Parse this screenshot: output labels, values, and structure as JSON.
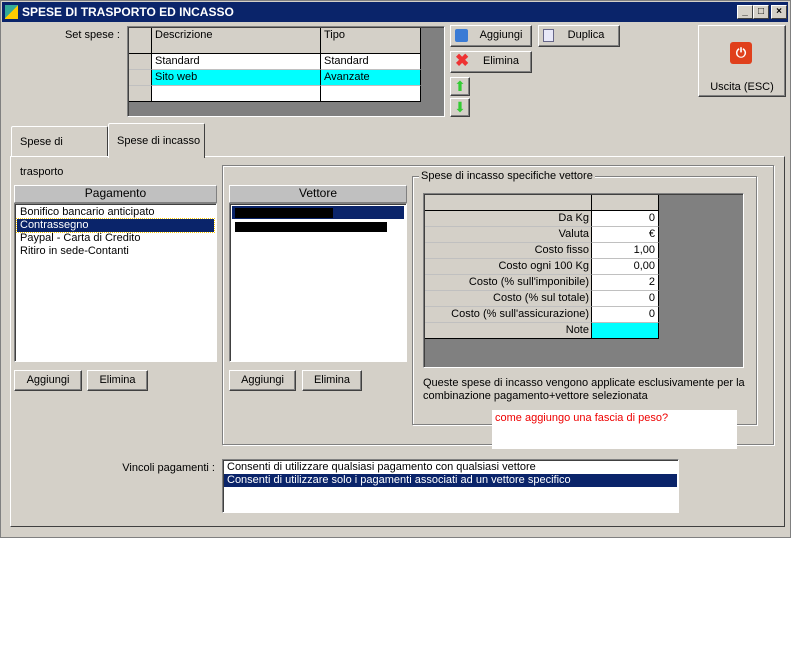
{
  "window": {
    "title": "SPESE DI TRASPORTO ED INCASSO",
    "min": "_",
    "max": "□",
    "close": "×"
  },
  "set_spese": {
    "label": "Set spese :",
    "columns": [
      "Descrizione",
      "Tipo"
    ],
    "rows": [
      {
        "descrizione": "Standard",
        "tipo": "Standard"
      },
      {
        "descrizione": "Sito web",
        "tipo": "Avanzate"
      }
    ]
  },
  "toolbar": {
    "aggiungi": "Aggiungi",
    "duplica": "Duplica",
    "elimina": "Elimina",
    "uscita": "Uscita (ESC)"
  },
  "tabs": [
    {
      "label": "Spese di trasporto"
    },
    {
      "label": "Spese di incasso"
    }
  ],
  "pagamento": {
    "header": "Pagamento",
    "items": [
      "Bonifico bancario anticipato",
      "Contrassegno",
      "Paypal - Carta di Credito",
      "Ritiro in sede-Contanti"
    ],
    "aggiungi": "Aggiungi",
    "elimina": "Elimina"
  },
  "vettore": {
    "header": "Vettore",
    "aggiungi": "Aggiungi",
    "elimina": "Elimina"
  },
  "specifiche": {
    "title": "Spese di incasso specifiche vettore",
    "rows": [
      {
        "label": "Da Kg",
        "value": "0"
      },
      {
        "label": "Valuta",
        "value": "€"
      },
      {
        "label": "Costo fisso",
        "value": "1,00"
      },
      {
        "label": "Costo ogni 100 Kg",
        "value": "0,00"
      },
      {
        "label": "Costo (% sull'imponibile)",
        "value": "2"
      },
      {
        "label": "Costo (% sul totale)",
        "value": "0"
      },
      {
        "label": "Costo (% sull'assicurazione)",
        "value": "0"
      },
      {
        "label": "Note",
        "value": ""
      }
    ],
    "note": "Queste spese di incasso vengono applicate esclusivamente per la combinazione pagamento+vettore selezionata"
  },
  "annotation": "come aggiungo una fascia di peso?",
  "vincoli": {
    "label": "Vincoli pagamenti :",
    "options": [
      "Consenti di utilizzare qualsiasi pagamento con qualsiasi vettore",
      "Consenti di utilizzare solo i pagamenti associati ad un vettore specifico"
    ]
  }
}
